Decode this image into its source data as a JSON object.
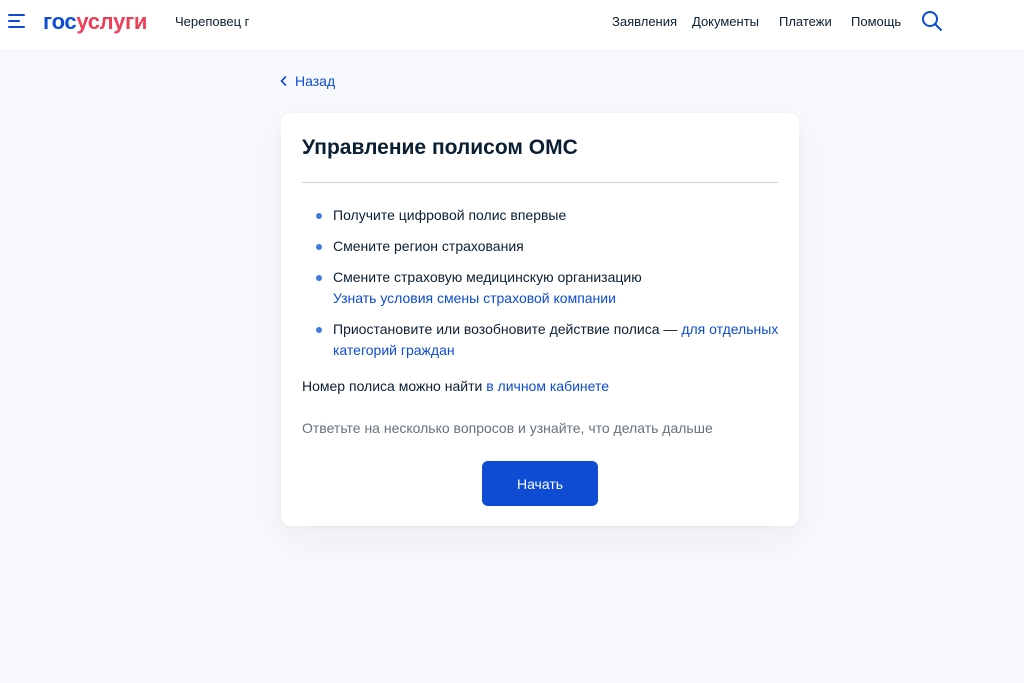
{
  "header": {
    "logo_part1": "гос",
    "logo_part2": "услуги",
    "city": "Череповец г",
    "nav": [
      "Заявления",
      "Документы",
      "Платежи",
      "Помощь"
    ],
    "menu_icon": "burger-menu-icon",
    "search_icon": "search-icon"
  },
  "back": {
    "label": "Назад",
    "icon": "chevron-left-icon"
  },
  "card": {
    "title": "Управление полисом ОМС",
    "items": [
      {
        "text": "Получите цифровой полис впервые"
      },
      {
        "text": "Смените регион страхования"
      },
      {
        "text": "Смените страховую медицинскую организацию",
        "link": "Узнать условия смены страховой компании"
      },
      {
        "text": "Приостановите или возобновите действие полиса — ",
        "link": "для отдельных категорий граждан"
      }
    ],
    "policy_text": "Номер полиса можно найти ",
    "policy_link": "в личном кабинете",
    "hint": "Ответьте на несколько вопросов и узнайте, что делать дальше",
    "start_label": "Начать"
  },
  "colors": {
    "primary": "#0d4cd3",
    "brand_red": "#ee3f58",
    "bullet": "#3f7ae0",
    "text": "#0b1f33",
    "muted": "#66727f"
  }
}
